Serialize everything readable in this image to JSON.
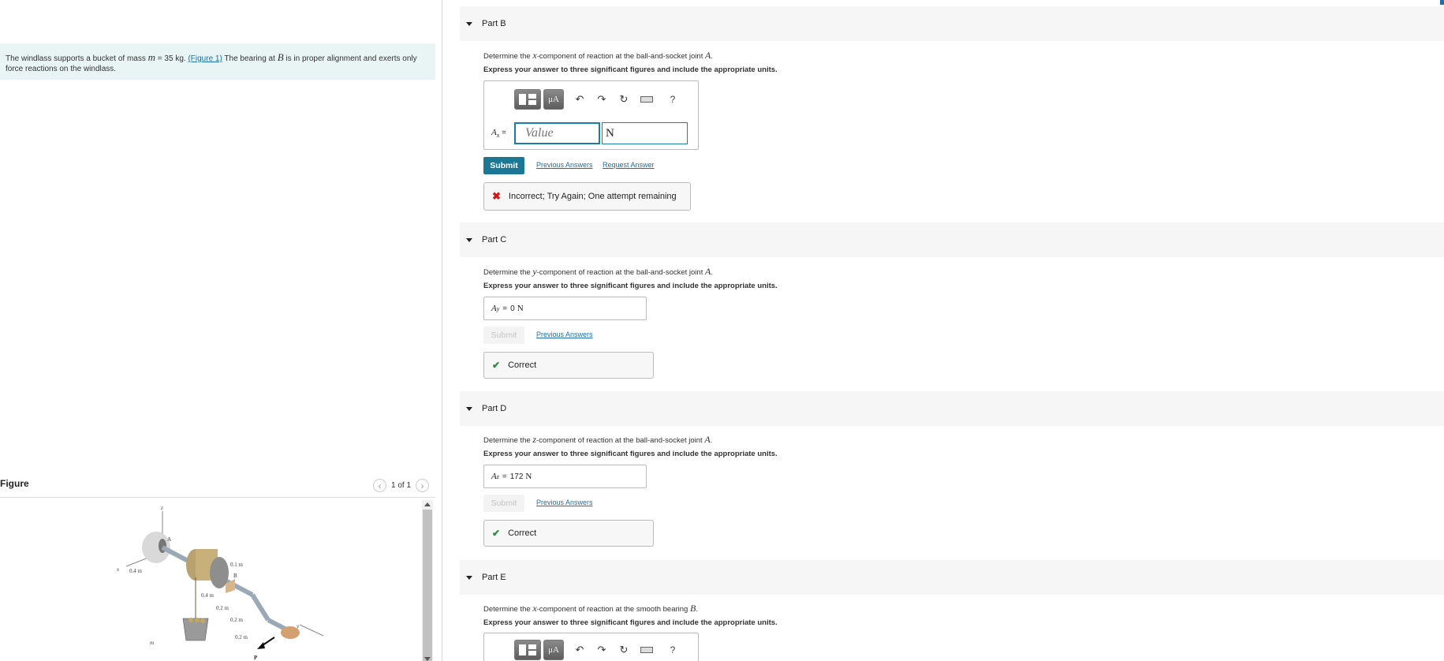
{
  "problem": {
    "text_before": "The windlass supports a bucket of mass ",
    "mass_symbol": "m",
    "mass_value": " = 35 kg. ",
    "figure_link": "(Figure 1)",
    "text_after": " The bearing at ",
    "bearing_symbol": "B",
    "text_end": " is in proper alignment and exerts only force reactions on the windlass."
  },
  "figure": {
    "label": "Figure",
    "pager": "1 of 1",
    "prev_icon": "chevron-left-icon",
    "next_icon": "chevron-right-icon",
    "labels": {
      "z": "z",
      "x": "x",
      "y": "y",
      "A": "A",
      "B": "B",
      "m": "m",
      "P": "P",
      "d04a": "0.4 m",
      "d04b": "0.4 m",
      "d01": "0.1 m",
      "d02a": "0.2 m",
      "d02b": "0.2 m",
      "d02c": "0.2 m"
    }
  },
  "parts": {
    "b": {
      "title": "Part B",
      "question_pre": "Determine the ",
      "component": "x",
      "question_post": "-component of reaction at the ball-and-socket joint ",
      "point": "A",
      "period": ".",
      "instruction": "Express your answer to three significant figures and include the appropriate units.",
      "answer_var": "A",
      "answer_sub": "x",
      "equals": " =",
      "value_placeholder": "Value",
      "unit_value": "N",
      "toolbar": {
        "template_icon": "template-icon",
        "mu_label": "μA",
        "undo_icon": "undo-icon",
        "redo_icon": "redo-icon",
        "reset_icon": "reset-icon",
        "keyboard_icon": "keyboard-icon",
        "help_label": "?"
      },
      "submit": "Submit",
      "previous_answers": "Previous Answers",
      "request_answer": "Request Answer",
      "feedback": "Incorrect; Try Again; One attempt remaining"
    },
    "c": {
      "title": "Part C",
      "question_pre": "Determine the ",
      "component": "y",
      "question_post": "-component of reaction at the ball-and-socket joint ",
      "point": "A",
      "period": ".",
      "instruction": "Express your answer to three significant figures and include the appropriate units.",
      "answer_var": "A",
      "answer_sub": "y",
      "equals": "=",
      "answer_value": "0",
      "answer_unit": "N",
      "submit": "Submit",
      "previous_answers": "Previous Answers",
      "feedback": "Correct"
    },
    "d": {
      "title": "Part D",
      "question_pre": "Determine the ",
      "component": "z",
      "question_post": "-component of reaction at the ball-and-socket joint ",
      "point": "A",
      "period": ".",
      "instruction": "Express your answer to three significant figures and include the appropriate units.",
      "answer_var": "A",
      "answer_sub": "z",
      "equals": "=",
      "answer_value": "172",
      "answer_unit": "N",
      "submit": "Submit",
      "previous_answers": "Previous Answers",
      "feedback": "Correct"
    },
    "e": {
      "title": "Part E",
      "question_pre": "Determine the ",
      "component": "x",
      "question_post": "-component of reaction at the smooth bearing ",
      "point": "B",
      "period": ".",
      "instruction": "Express your answer to three significant figures and include the appropriate units.",
      "toolbar": {
        "mu_label": "μA",
        "help_label": "?"
      }
    }
  },
  "colors": {
    "accent": "#1a7894",
    "link": "#1a6fa8",
    "incorrect": "#dd1111",
    "correct": "#2b8a3e",
    "problem_bg": "#e9f5f5"
  }
}
